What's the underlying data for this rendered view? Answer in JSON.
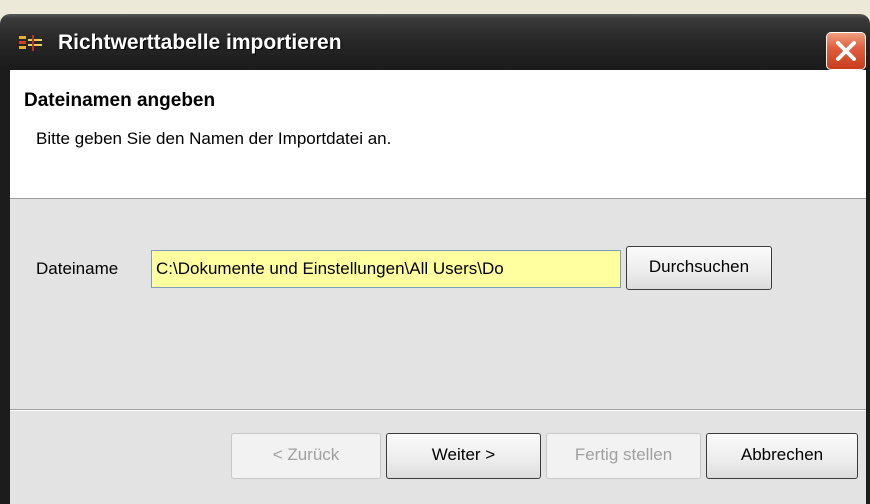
{
  "window": {
    "title": "Richtwerttabelle importieren",
    "icon": "app-icon",
    "close_icon": "close-icon"
  },
  "header": {
    "title": "Dateinamen angeben",
    "description": "Bitte geben Sie den Namen der Importdatei an."
  },
  "form": {
    "file_label": "Dateiname",
    "file_value": "C:\\Dokumente und Einstellungen\\All Users\\Do",
    "browse_label": "Durchsuchen"
  },
  "footer": {
    "back_label": "< Zurück",
    "next_label": "Weiter >",
    "finish_label": "Fertig stellen",
    "cancel_label": "Abbrechen"
  },
  "colors": {
    "titlebar": "#1b1b1b",
    "close_button": "#e06040",
    "input_background": "#ffffa0",
    "dialog_background": "#e3e3e3"
  }
}
